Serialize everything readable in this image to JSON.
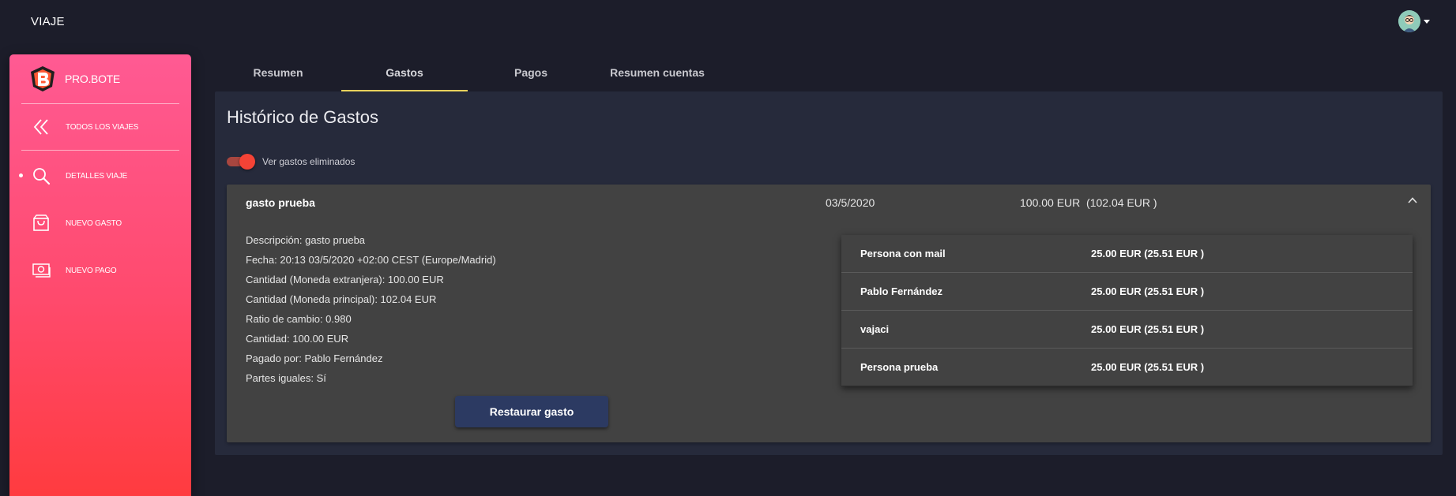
{
  "header": {
    "title": "VIAJE"
  },
  "sidebar": {
    "brand": "PRO.BOTE",
    "back_label": "TODOS LOS VIAJES",
    "items": [
      {
        "label": "DETALLES VIAJE",
        "icon": "search-icon",
        "active": true
      },
      {
        "label": "NUEVO GASTO",
        "icon": "shopping-bag-icon",
        "active": false
      },
      {
        "label": "NUEVO PAGO",
        "icon": "money-icon",
        "active": false
      }
    ]
  },
  "tabs": [
    "Resumen",
    "Gastos",
    "Pagos",
    "Resumen cuentas"
  ],
  "active_tab": "Gastos",
  "page": {
    "title": "Histórico de Gastos",
    "toggle_label": "Ver gastos eliminados",
    "toggle_on": true
  },
  "expense": {
    "name": "gasto prueba",
    "date": "03/5/2020",
    "amount": "100.00 EUR  (102.04 EUR )",
    "details": [
      "Descripción: gasto prueba",
      "Fecha: 20:13 03/5/2020 +02:00 CEST (Europe/Madrid)",
      "Cantidad (Moneda extranjera): 100.00 EUR",
      "Cantidad (Moneda principal): 102.04 EUR",
      "Ratio de cambio: 0.980",
      "Cantidad: 100.00 EUR",
      "Pagado por: Pablo Fernández",
      "Partes iguales: Sí"
    ],
    "restore_label": "Restaurar gasto",
    "splits": [
      {
        "name": "Persona con mail",
        "amount": "25.00 EUR (25.51 EUR )"
      },
      {
        "name": "Pablo Fernández",
        "amount": "25.00 EUR (25.51 EUR )"
      },
      {
        "name": "vajaci",
        "amount": "25.00 EUR (25.51 EUR )"
      },
      {
        "name": "Persona prueba",
        "amount": "25.00 EUR (25.51 EUR )"
      }
    ]
  },
  "colors": {
    "background": "#1c1d2a",
    "panel": "#262a3b",
    "card": "#424242",
    "sidebar_top": "#ff5a93",
    "sidebar_bottom": "#ff3b3f",
    "tab_indicator": "#e8d25c",
    "toggle": "#f44336",
    "button": "#2c3a62"
  }
}
